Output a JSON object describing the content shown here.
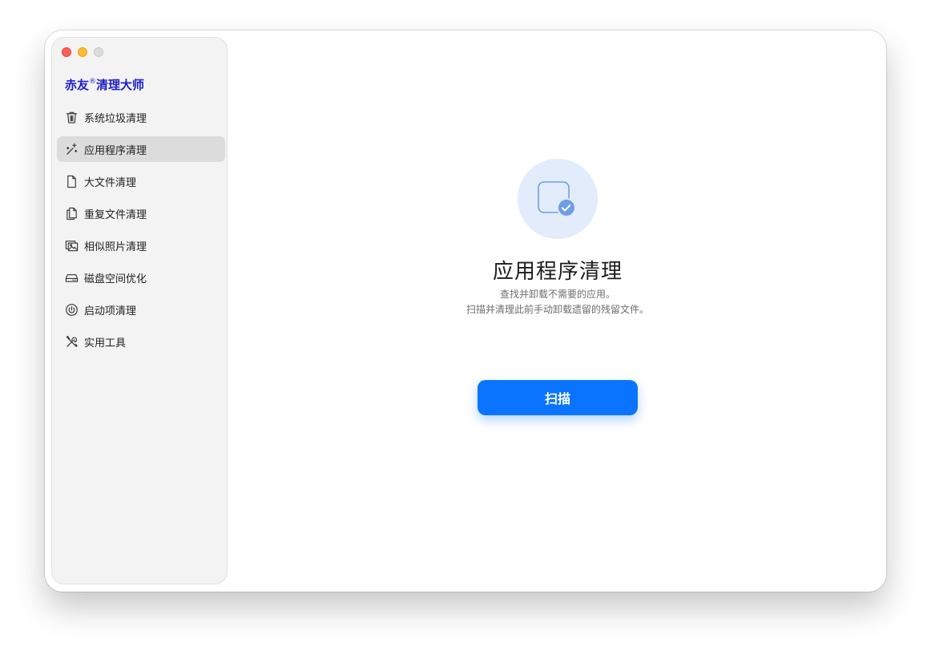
{
  "window": {
    "controls": [
      "close",
      "minimize",
      "maximize"
    ]
  },
  "sidebar": {
    "brand_name": "赤友",
    "brand_mark": "®",
    "brand_suffix": "清理大师",
    "brand_color": "#1d20c9",
    "items": [
      {
        "label": "系统垃圾清理",
        "icon": "trash-icon",
        "active": false
      },
      {
        "label": "应用程序清理",
        "icon": "magic-wand-icon",
        "active": true
      },
      {
        "label": "大文件清理",
        "icon": "document-icon",
        "active": false
      },
      {
        "label": "重复文件清理",
        "icon": "duplicate-document-icon",
        "active": false
      },
      {
        "label": "相似照片清理",
        "icon": "photo-icon",
        "active": false
      },
      {
        "label": "磁盘空间优化",
        "icon": "disk-drive-icon",
        "active": false
      },
      {
        "label": "启动项清理",
        "icon": "power-icon",
        "active": false
      },
      {
        "label": "实用工具",
        "icon": "tools-icon",
        "active": false
      }
    ]
  },
  "main": {
    "hero_icon": "app-window-check-icon",
    "title": "应用程序清理",
    "description_line1": "查找并卸载不需要的应用。",
    "description_line2": "扫描并清理此前手动卸载遗留的残留文件。",
    "scan_button_label": "扫描",
    "accent_color": "#0a74ff"
  }
}
